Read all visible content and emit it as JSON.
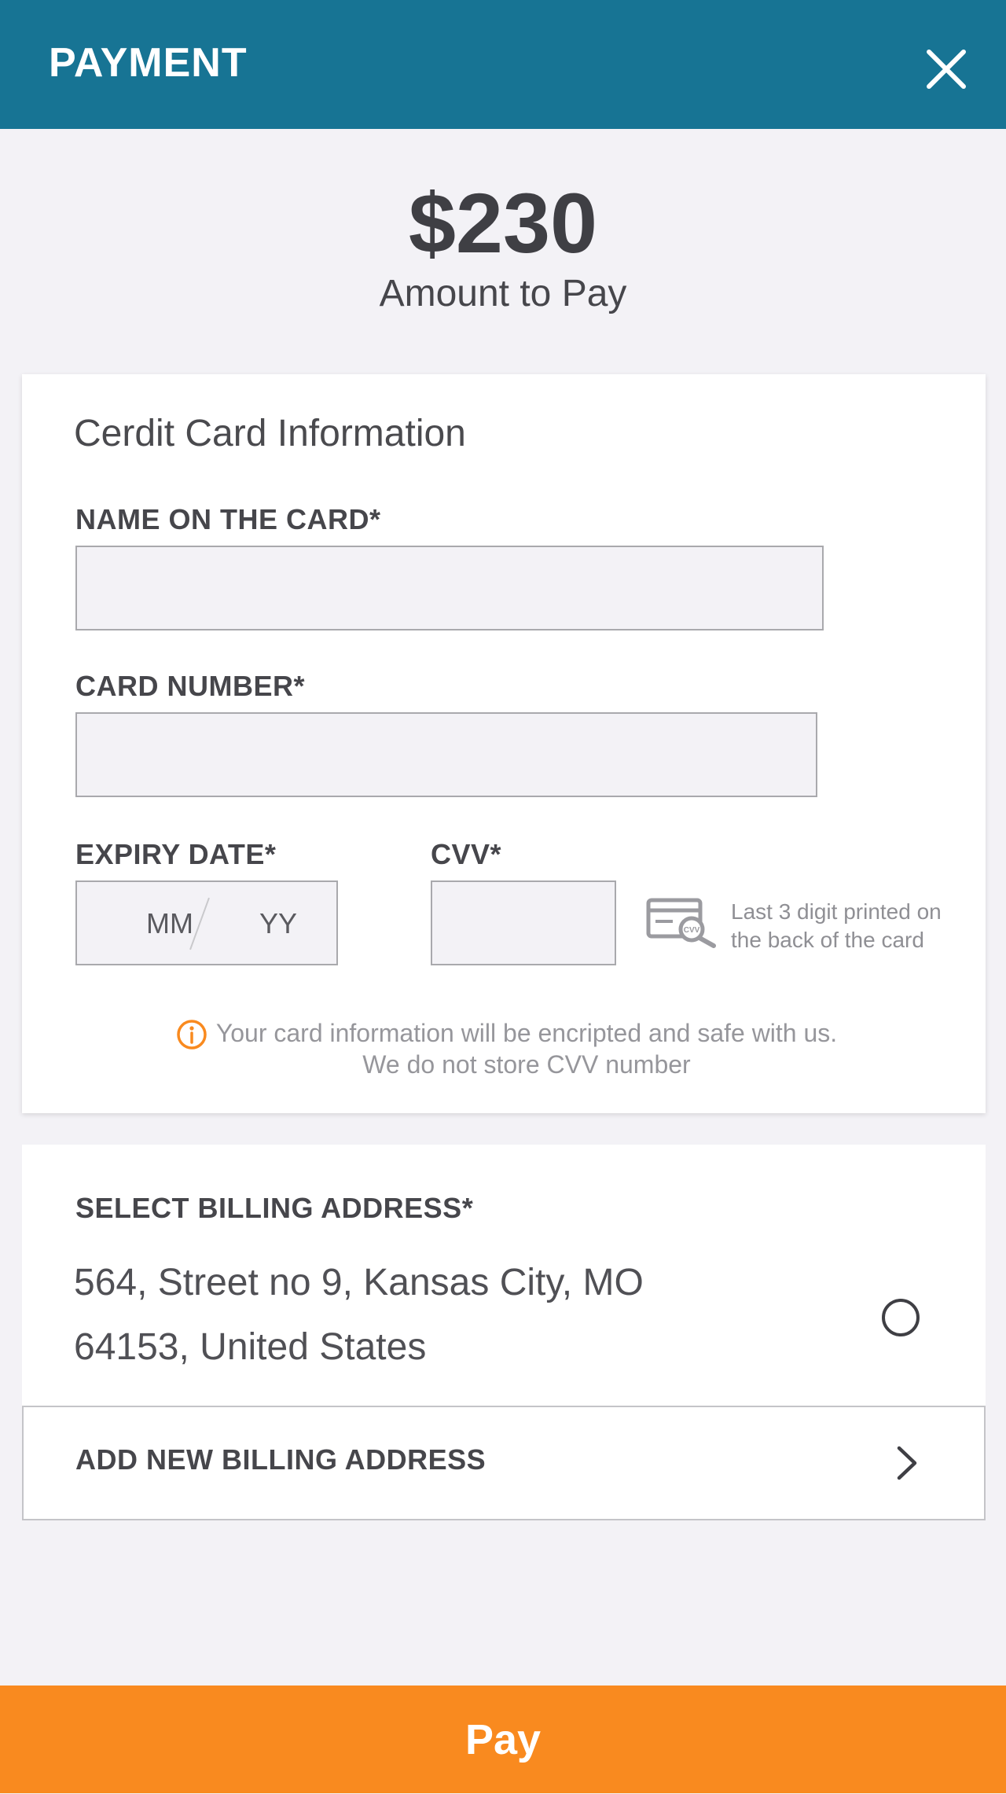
{
  "header": {
    "title": "PAYMENT",
    "close_icon": "close-icon"
  },
  "summary": {
    "amount": "$230",
    "amount_label": "Amount to Pay"
  },
  "card_info": {
    "title": "Cerdit Card Information",
    "name_label": "NAME ON THE CARD*",
    "name_value": "",
    "number_label": "CARD NUMBER*",
    "number_value": "",
    "expiry_label": "EXPIRY DATE*",
    "expiry_month_placeholder": "MM",
    "expiry_year_placeholder": "YY",
    "cvv_label": "CVV*",
    "cvv_value": "",
    "cvv_icon": "card-search-icon",
    "cvv_icon_text": "CVV",
    "cvv_hint_line1": "Last 3 digit printed on",
    "cvv_hint_line2": "the back of the card",
    "security_icon": "info-icon",
    "security_line1": "Your card information will be encripted and safe with us.",
    "security_line2": "We do not store CVV number"
  },
  "billing": {
    "label": "SELECT BILLING ADDRESS*",
    "address_line1": "564, Street no 9, Kansas City, MO",
    "address_line2": "64153, United States",
    "selected": false,
    "add_label": "ADD NEW BILLING ADDRESS",
    "add_icon": "chevron-right-icon"
  },
  "footer": {
    "pay_label": "Pay"
  },
  "colors": {
    "header_bg": "#177494",
    "accent": "#f98a1f",
    "page_bg": "#f3f2f6",
    "text": "#4a4a4e",
    "muted": "#96969b"
  }
}
